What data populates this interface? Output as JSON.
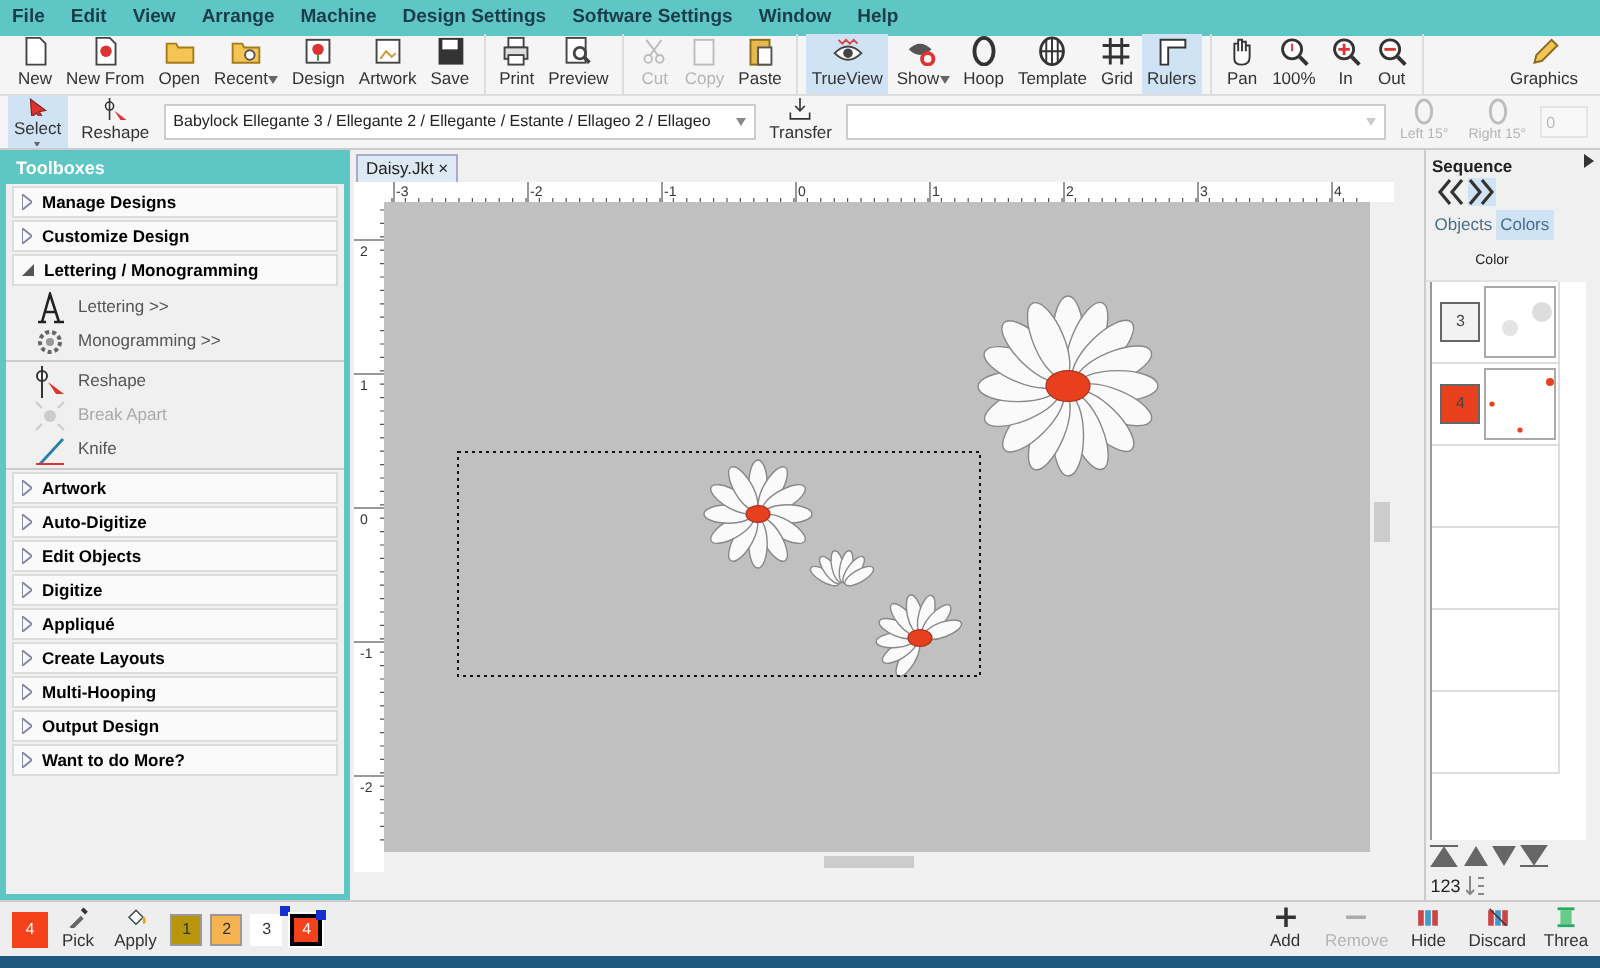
{
  "menu_bar": [
    "File",
    "Edit",
    "View",
    "Arrange",
    "Machine",
    "Design Settings",
    "Software Settings",
    "Window",
    "Help"
  ],
  "toolbar": {
    "groups": [
      [
        {
          "label": "New",
          "disabled": false,
          "on": false,
          "dropdown": false
        },
        {
          "label": "New From",
          "disabled": false,
          "on": false,
          "dropdown": false
        },
        {
          "label": "Open",
          "disabled": false,
          "on": false,
          "dropdown": false
        },
        {
          "label": "Recent",
          "disabled": false,
          "on": false,
          "dropdown": true
        },
        {
          "label": "Design",
          "disabled": false,
          "on": false,
          "dropdown": false
        },
        {
          "label": "Artwork",
          "disabled": false,
          "on": false,
          "dropdown": false
        },
        {
          "label": "Save",
          "disabled": false,
          "on": false,
          "dropdown": false
        }
      ],
      [
        {
          "label": "Print",
          "disabled": false,
          "on": false,
          "dropdown": false
        },
        {
          "label": "Preview",
          "disabled": false,
          "on": false,
          "dropdown": false
        }
      ],
      [
        {
          "label": "Cut",
          "disabled": true,
          "on": false,
          "dropdown": false
        },
        {
          "label": "Copy",
          "disabled": true,
          "on": false,
          "dropdown": false
        },
        {
          "label": "Paste",
          "disabled": false,
          "on": false,
          "dropdown": false
        }
      ],
      [
        {
          "label": "TrueView",
          "disabled": false,
          "on": true,
          "dropdown": false
        },
        {
          "label": "Show",
          "disabled": false,
          "on": false,
          "dropdown": true
        },
        {
          "label": "Hoop",
          "disabled": false,
          "on": false,
          "dropdown": false
        },
        {
          "label": "Template",
          "disabled": false,
          "on": false,
          "dropdown": false
        },
        {
          "label": "Grid",
          "disabled": false,
          "on": false,
          "dropdown": false
        },
        {
          "label": "Rulers",
          "disabled": false,
          "on": true,
          "dropdown": false
        }
      ],
      [
        {
          "label": "Pan",
          "disabled": false,
          "on": false,
          "dropdown": false
        },
        {
          "label": "100%",
          "disabled": false,
          "on": false,
          "dropdown": false
        },
        {
          "label": "In",
          "disabled": false,
          "on": false,
          "dropdown": false
        },
        {
          "label": "Out",
          "disabled": false,
          "on": false,
          "dropdown": false
        }
      ],
      [
        {
          "label": "Graphics",
          "disabled": false,
          "on": false,
          "dropdown": false
        }
      ]
    ]
  },
  "tool_row": {
    "tools": [
      {
        "label": "Select",
        "selected": true,
        "dropdown": true
      },
      {
        "label": "Reshape",
        "selected": false,
        "dropdown": false
      }
    ],
    "machine_combo": {
      "value": "Babylock Ellegante 3 / Ellegante 2 / Ellegante / Estante / Ellageo 2 / Ellageo"
    },
    "transfer": "Transfer",
    "rotate": [
      {
        "label": "Left 15°",
        "disabled": true
      },
      {
        "label": "Right 15°",
        "disabled": true
      }
    ],
    "angle_field": {
      "value": "0",
      "disabled": true
    }
  },
  "toolboxes": {
    "title": "Toolboxes",
    "sections": [
      {
        "label": "Manage Designs",
        "expanded": false
      },
      {
        "label": "Customize Design",
        "expanded": false
      },
      {
        "label": "Lettering / Monogramming",
        "expanded": true,
        "groups": [
          [
            {
              "label": "Lettering >>",
              "disabled": false
            },
            {
              "label": "Monogramming >>",
              "disabled": false
            }
          ],
          [
            {
              "label": "Reshape",
              "disabled": false
            },
            {
              "label": "Break Apart",
              "disabled": true
            },
            {
              "label": "Knife",
              "disabled": false
            }
          ]
        ]
      },
      {
        "label": "Artwork",
        "expanded": false
      },
      {
        "label": "Auto-Digitize",
        "expanded": false
      },
      {
        "label": "Edit Objects",
        "expanded": false
      },
      {
        "label": "Digitize",
        "expanded": false
      },
      {
        "label": "Appliqué",
        "expanded": false
      },
      {
        "label": "Create Layouts",
        "expanded": false
      },
      {
        "label": "Multi-Hooping",
        "expanded": false
      },
      {
        "label": "Output Design",
        "expanded": false
      },
      {
        "label": "Want to do More?",
        "expanded": false
      }
    ]
  },
  "document_tab": {
    "label": "Daisy.Jkt",
    "close": "×"
  },
  "rulers": {
    "horizontal": [
      "-3",
      "-2",
      "-1",
      "0",
      "1",
      "2",
      "3",
      "4"
    ],
    "vertical": [
      "2",
      "1",
      "0",
      "-1",
      "-2"
    ]
  },
  "sequence": {
    "title": "Sequence",
    "tabs": [
      {
        "label": "Objects",
        "selected": false
      },
      {
        "label": "Colors",
        "selected": true
      }
    ],
    "column": "Color",
    "rows": [
      {
        "number": "3",
        "color": "#f2f2f2"
      },
      {
        "number": "4",
        "color": "#e8401c"
      }
    ],
    "sort_label": "123"
  },
  "color_bar": {
    "current": {
      "number": "4",
      "color": "#f5421a"
    },
    "tools": [
      "Pick",
      "Apply"
    ],
    "palette": [
      {
        "number": "1",
        "color": "#b8960c",
        "selected": false,
        "used": false
      },
      {
        "number": "2",
        "color": "#f7b252",
        "selected": false,
        "used": false
      },
      {
        "number": "3",
        "color": "#ffffff",
        "selected": false,
        "used": true
      },
      {
        "number": "4",
        "color": "#f5421a",
        "selected": true,
        "used": true
      }
    ],
    "actions": [
      {
        "label": "Add",
        "disabled": false
      },
      {
        "label": "Remove",
        "disabled": true
      },
      {
        "label": "Hide",
        "disabled": false
      },
      {
        "label": "Discard",
        "disabled": false
      },
      {
        "label": "Threa",
        "disabled": false
      }
    ]
  }
}
